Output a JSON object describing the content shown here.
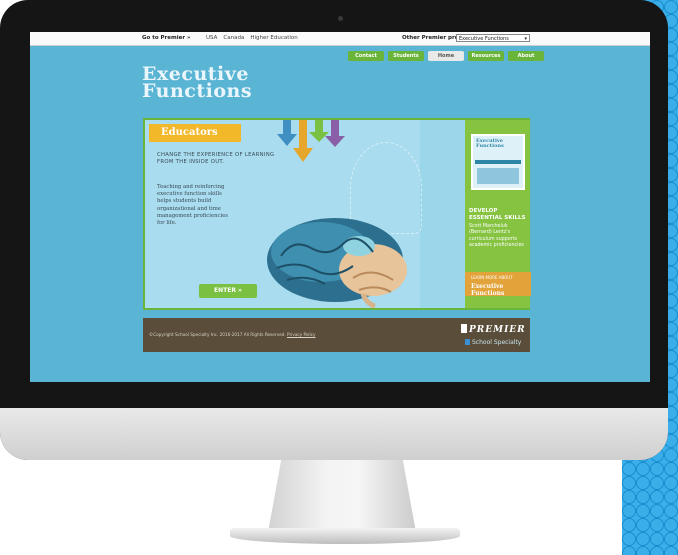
{
  "topbar": {
    "goto_label": "Go to Premier »",
    "links": [
      "USA",
      "Canada",
      "Higher Education"
    ],
    "other_label": "Other Premier product lines?",
    "select_value": "Executive Functions"
  },
  "nav": {
    "tabs": [
      "Contact",
      "Students",
      "Home",
      "Resources",
      "About"
    ],
    "active": "Home"
  },
  "logo": {
    "line1": "Executive",
    "line2": "Functions"
  },
  "main": {
    "tag": "Educators",
    "headline": "CHANGE THE EXPERIENCE OF LEARNING FROM THE INSIDE OUT.",
    "body": "Teaching and reinforcing executive function skills helps students build organizational and time management proficiencies for life.",
    "enter_label": "ENTER »"
  },
  "side": {
    "thumb_logo_line1": "Executive",
    "thumb_logo_line2": "Functions",
    "title": "DEVELOP ESSENTIAL SKILLS",
    "body": "Scott Marcheluk (Bernard) Lentz's curriculum supports academic proficiencies",
    "learn_small": "LEARN MORE ABOUT",
    "learn_big": "Executive Functions"
  },
  "footer": {
    "copyright": "©Copyright School Specialty Inc. 2016-2017 All Rights Reserved.",
    "privacy": "Privacy Policy",
    "brand": "PREMIER",
    "parent": "School Specialty"
  },
  "colors": {
    "screen_bg": "#5ab4d4",
    "accent_green": "#6ab43a",
    "accent_orange": "#f2b829",
    "footer_bg": "#5a4e3a"
  }
}
